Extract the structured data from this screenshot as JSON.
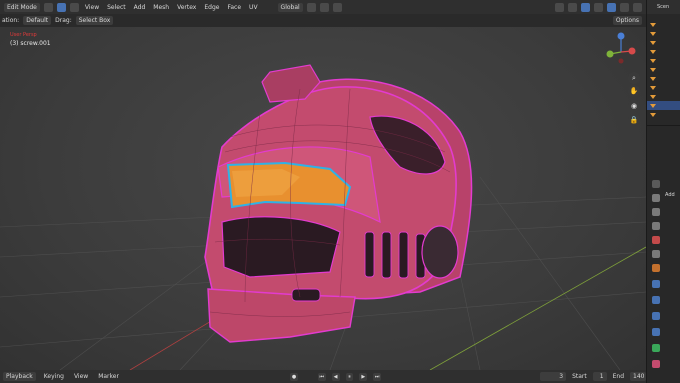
{
  "header": {
    "mode": "Edit Mode",
    "menus": [
      "View",
      "Select",
      "Add",
      "Mesh",
      "Vertex",
      "Edge",
      "Face",
      "UV"
    ],
    "transform_orientation": "Global"
  },
  "tool_options": {
    "orientation_label": "ation:",
    "orientation_value": "Default",
    "drag_label": "Drag:",
    "drag_value": "Select Box",
    "options_label": "Options"
  },
  "viewport": {
    "view_label": "User Persp",
    "object_name": "(3) screw.001"
  },
  "right_panel": {
    "header": "Scen",
    "add_label": "Add"
  },
  "timeline": {
    "menus": [
      "Playback",
      "Keying",
      "View",
      "Marker"
    ],
    "current_frame": "3",
    "start_label": "Start",
    "start_value": "1",
    "end_label": "End",
    "end_value": "140"
  },
  "colors": {
    "accent": "#4772b3",
    "helmet": "#c34b6e",
    "visor": "#e8902f",
    "selection_outline": "#e33bcf"
  }
}
